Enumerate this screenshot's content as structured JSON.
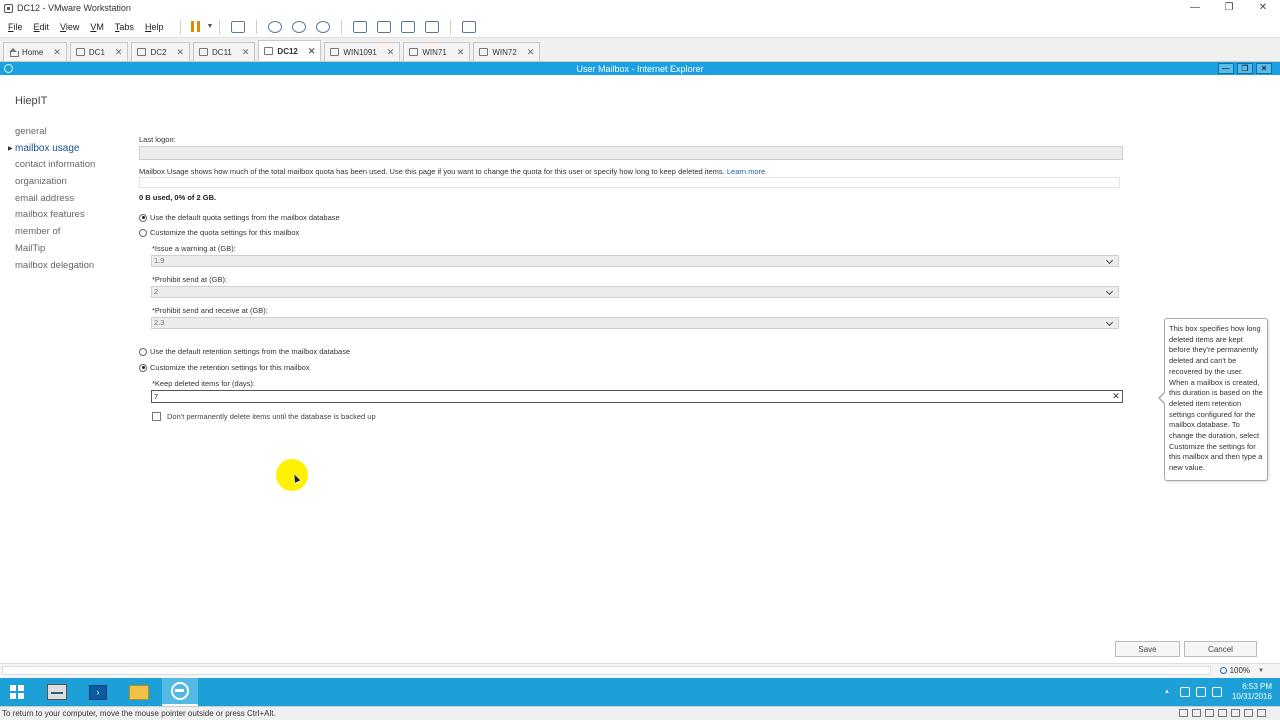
{
  "vmware": {
    "title": "DC12 - VMware Workstation",
    "menu": [
      {
        "accel": "F",
        "rest": "ile"
      },
      {
        "accel": "E",
        "rest": "dit"
      },
      {
        "accel": "V",
        "rest": "iew"
      },
      {
        "accel": "V",
        "rest": "M"
      },
      {
        "accel": "T",
        "rest": "abs"
      },
      {
        "accel": "H",
        "rest": "elp"
      }
    ],
    "tabs": [
      {
        "label": "Home",
        "active": false
      },
      {
        "label": "DC1",
        "active": false
      },
      {
        "label": "DC2",
        "active": false
      },
      {
        "label": "DC11",
        "active": false
      },
      {
        "label": "DC12",
        "active": true
      },
      {
        "label": "WIN1091",
        "active": false
      },
      {
        "label": "WIN71",
        "active": false
      },
      {
        "label": "WIN72",
        "active": false
      }
    ],
    "status_text": "To return to your computer, move the mouse pointer outside or press Ctrl+Alt."
  },
  "ie": {
    "title": "User Mailbox - Internet Explorer",
    "zoom": "100%"
  },
  "page": {
    "user_name": "HiepIT",
    "nav": [
      {
        "label": "general",
        "active": false
      },
      {
        "label": "mailbox usage",
        "active": true
      },
      {
        "label": "contact information",
        "active": false
      },
      {
        "label": "organization",
        "active": false
      },
      {
        "label": "email address",
        "active": false
      },
      {
        "label": "mailbox features",
        "active": false
      },
      {
        "label": "member of",
        "active": false
      },
      {
        "label": "MailTip",
        "active": false
      },
      {
        "label": "mailbox delegation",
        "active": false
      }
    ],
    "last_logon_label": "Last logon:",
    "description": "Mailbox Usage shows how much of the total mailbox quota has been used. Use this page if you want to change the quota for this user or specify how long to keep deleted items.",
    "learn_more": "Learn more",
    "usage": "0 B used, 0% of 2 GB.",
    "quota_default_label": "Use the default quota settings from the mailbox database",
    "quota_custom_label": "Customize the quota settings for this mailbox",
    "warning_label": "*Issue a warning at (GB):",
    "warning_value": "1.9",
    "prohibit_send_label": "*Prohibit send at (GB):",
    "prohibit_send_value": "2",
    "prohibit_send_receive_label": "*Prohibit send and receive at (GB):",
    "prohibit_send_receive_value": "2.3",
    "retention_default_label": "Use the default retention settings from the mailbox database",
    "retention_custom_label": "Customize the retention settings for this mailbox",
    "keep_deleted_label": "*Keep deleted items for (days):",
    "keep_deleted_value": "7",
    "dont_delete_label": "Don't permanently delete items until the database is backed up",
    "tooltip": "This box specifies how long deleted items are kept before they're permanently deleted and can't be recovered by the user. When a mailbox is created, this duration is based on the deleted item retention settings configured for the mailbox database. To change the duration, select Customize the settings for this mailbox and then type a new value.",
    "save": "Save",
    "cancel": "Cancel"
  },
  "taskbar": {
    "time": "6:53 PM",
    "date": "10/31/2016"
  },
  "colors": {
    "taskbar": "#1d9fd8",
    "ie_titlebar": "#1ba1e2",
    "nav_active": "#1d4f8f",
    "link": "#1d5fa8",
    "cursor_highlight": "#fff200"
  }
}
